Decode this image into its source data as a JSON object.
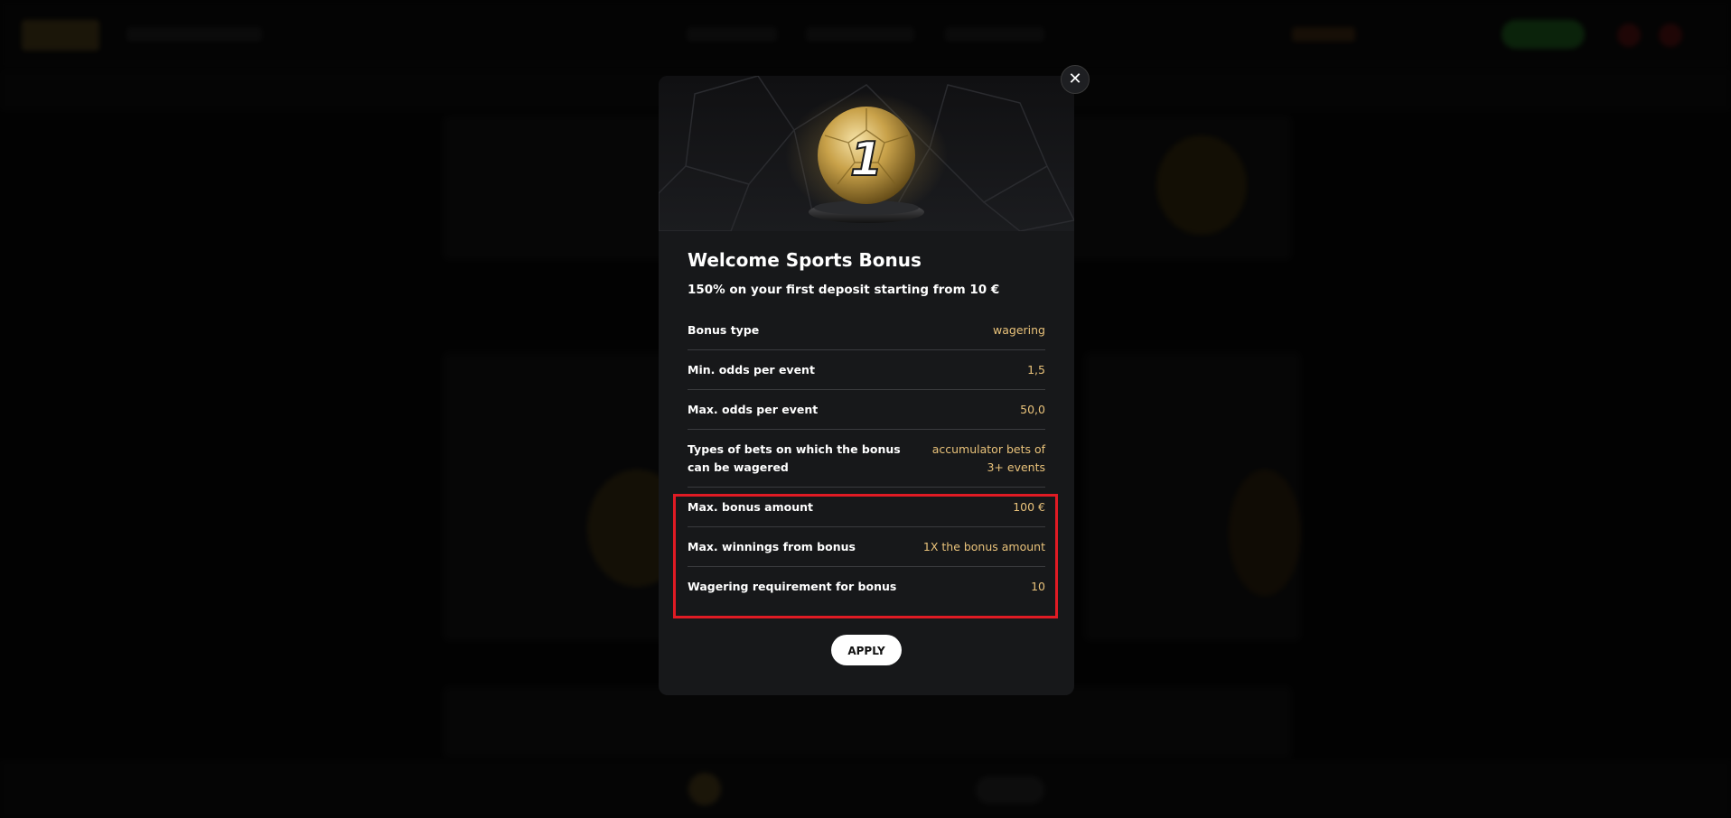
{
  "modal": {
    "close_symbol": "✕",
    "badge_number": "1",
    "title": "Welcome Sports Bonus",
    "subtitle": "150% on your first deposit starting from 10 €",
    "rows": [
      {
        "label": "Bonus type",
        "value": "wagering"
      },
      {
        "label": "Min. odds per event",
        "value": "1,5"
      },
      {
        "label": "Max. odds per event",
        "value": "50,0"
      },
      {
        "label": "Types of bets on which the bonus can be wagered",
        "value": "accumulator bets of 3+ events"
      },
      {
        "label": "Max. bonus amount",
        "value": "100 €"
      },
      {
        "label": "Max. winnings from bonus",
        "value": "1X the bonus amount"
      },
      {
        "label": "Wagering requirement for bonus",
        "value": "10"
      }
    ],
    "apply_label": "APPLY"
  },
  "colors": {
    "accent_value": "#e9c27a",
    "highlight": "#e01b24",
    "modal_bg": "#17181a"
  },
  "icons": {
    "close": "close-icon",
    "banner": "golden-football-trophy-icon"
  }
}
